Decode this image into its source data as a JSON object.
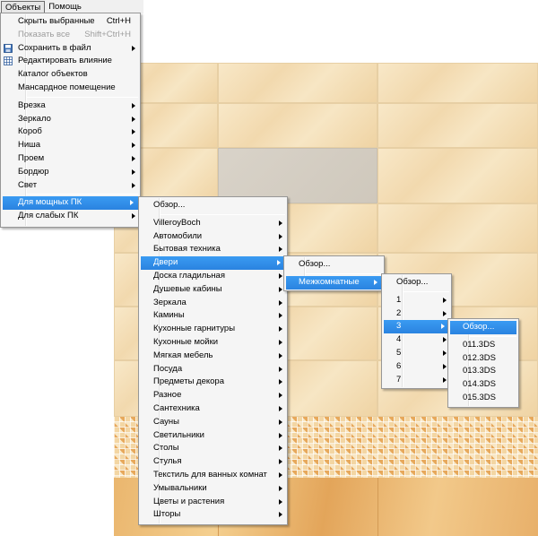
{
  "menubar": {
    "items": [
      "Объекты",
      "Помощь"
    ]
  },
  "objects_menu": {
    "group1": [
      {
        "label": "Скрыть выбранные",
        "shortcut": "Ctrl+H",
        "enabled": true
      },
      {
        "label": "Показать все",
        "shortcut": "Shift+Ctrl+H",
        "enabled": false
      },
      {
        "label": "Сохранить в файл",
        "icon": "save-icon",
        "submenu": true
      },
      {
        "label": "Редактировать влияние",
        "icon": "edit-grid-icon"
      },
      {
        "label": "Каталог объектов"
      },
      {
        "label": "Мансардное помещение"
      }
    ],
    "group2": [
      "Врезка",
      "Зеркало",
      "Короб",
      "Ниша",
      "Проем",
      "Бордюр",
      "Свет"
    ],
    "group3": [
      "Для мощных ПК",
      "Для слабых ПК"
    ]
  },
  "powerful_pc_menu": {
    "overview": "Обзор...",
    "items": [
      "VilleroyBoch",
      "Автомобили",
      "Бытовая техника",
      "Двери",
      "Доска гладильная",
      "Душевые кабины",
      "Зеркала",
      "Камины",
      "Кухонные гарнитуры",
      "Кухонные мойки",
      "Мягкая мебель",
      "Посуда",
      "Предметы декора",
      "Разное",
      "Сантехника",
      "Сауны",
      "Светильники",
      "Столы",
      "Стулья",
      "Текстиль для ванных комнат",
      "Умывальники",
      "Цветы и растения",
      "Шторы"
    ]
  },
  "doors_menu": {
    "overview": "Обзор...",
    "items": [
      "Межкомнатные"
    ]
  },
  "interior_menu": {
    "overview": "Обзор...",
    "items": [
      "1",
      "2",
      "3",
      "4",
      "5",
      "6",
      "7"
    ]
  },
  "models_menu": {
    "overview": "Обзор...",
    "items": [
      "011.3DS",
      "012.3DS",
      "013.3DS",
      "014.3DS",
      "015.3DS"
    ]
  },
  "colors": {
    "highlight": "#2a83e0",
    "menu_bg": "#f5f5f5",
    "tile": "#f4dfb7"
  }
}
